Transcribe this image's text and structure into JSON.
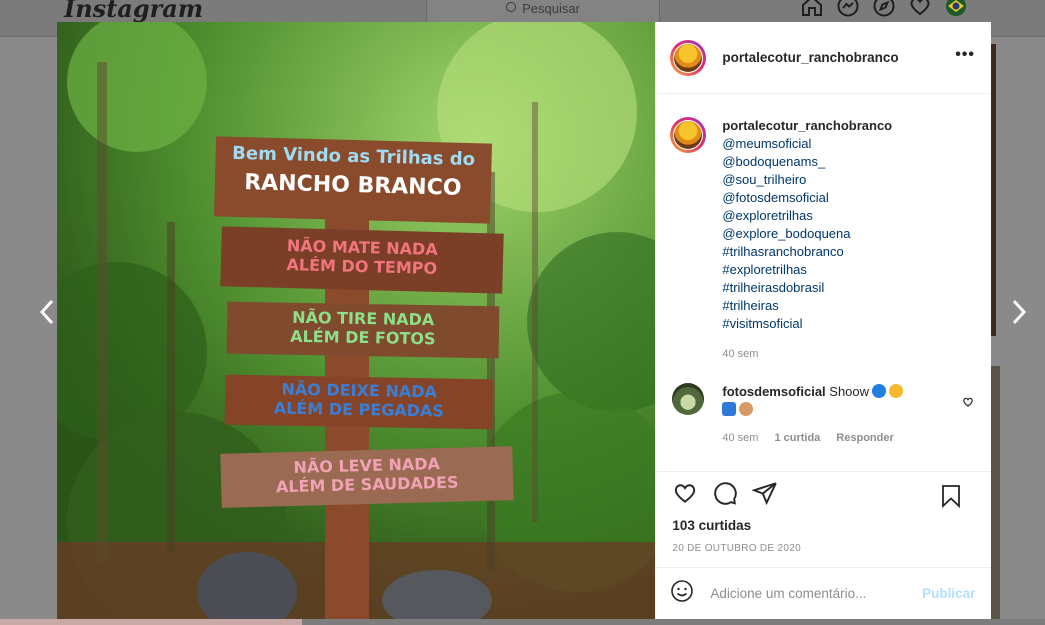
{
  "app": {
    "logo": "Instagram",
    "search_placeholder": "Pesquisar"
  },
  "nav": {
    "icons": [
      "home-icon",
      "messenger-icon",
      "explore-icon",
      "activity-heart-icon",
      "profile-avatar-icon"
    ]
  },
  "post": {
    "username": "portalecotur_ranchobranco",
    "more_label": "•••",
    "caption": {
      "username": "portalecotur_ranchobranco",
      "lines": [
        "@meumsoficial",
        "@bodoquenams_",
        "@sou_trilheiro",
        "@fotosdemsoficial",
        "@exploretrilhas",
        "@explore_bodoquena",
        "#trilhasranchobranco",
        "#exploretrilhas",
        "#trilheirasdobrasil",
        "#trilheiras",
        "#visitmsoficial"
      ],
      "time": "40 sem"
    },
    "comment": {
      "username": "fotosdemsoficial",
      "text": "Shoow",
      "time": "40 sem",
      "likes": "1 curtida",
      "reply": "Responder"
    },
    "likes": "103 curtidas",
    "date": "20 DE OUTUBRO DE 2020",
    "add_comment_placeholder": "Adicione um comentário...",
    "publish_label": "Publicar"
  },
  "photo_signs": [
    {
      "line1": "Bem Vindo as Trilhas do",
      "line2": "RANCHO BRANCO"
    },
    {
      "line1": "NÃO MATE NADA",
      "line2": "ALÉM DO TEMPO"
    },
    {
      "line1": "NÃO TIRE NADA",
      "line2": "ALÉM DE FOTOS"
    },
    {
      "line1": "NÃO DEIXE NADA",
      "line2": "ALÉM DE PEGADAS"
    },
    {
      "line1": "NÃO LEVE NADA",
      "line2": "ALÉM DE SAUDADES"
    }
  ],
  "colors": {
    "link": "#00376b",
    "publish": "#b2dffc",
    "sign_wood": "#8a4b2d"
  }
}
